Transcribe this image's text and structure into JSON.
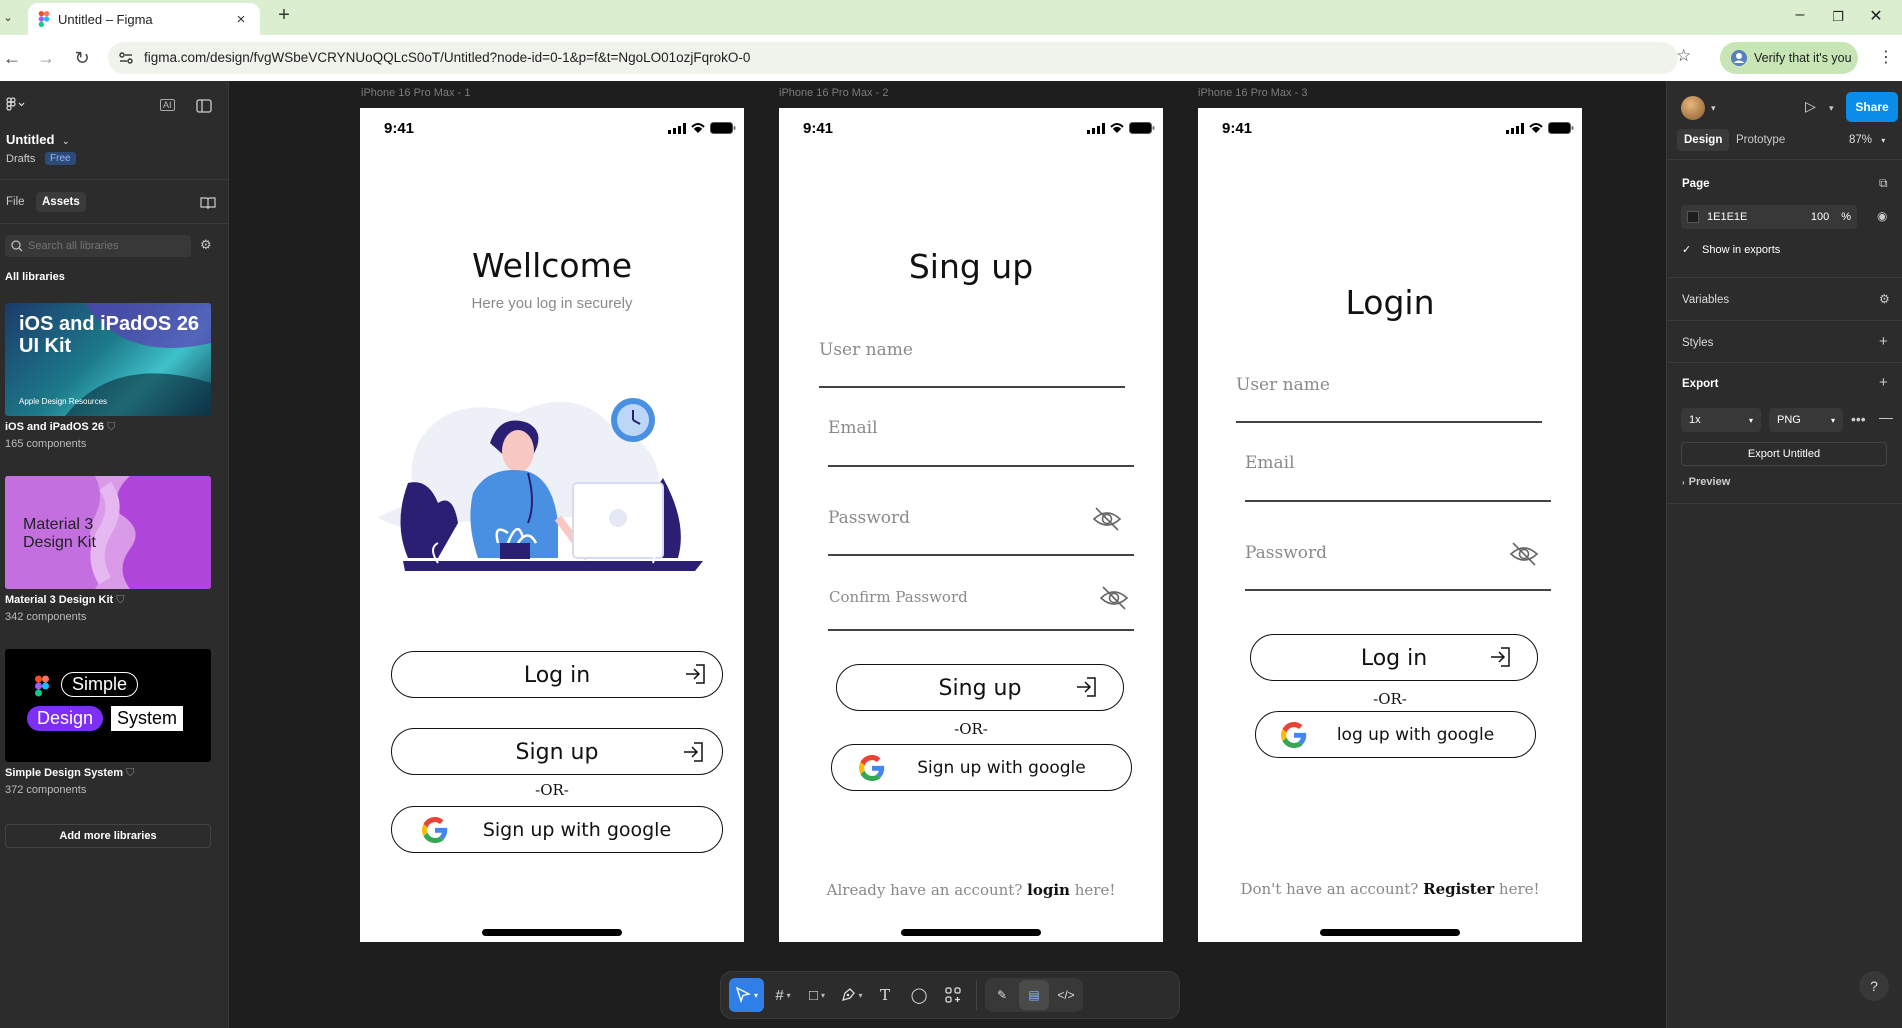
{
  "browser": {
    "tab_title": "Untitled – Figma",
    "url": "figma.com/design/fvgWSbeVCRYNUoQQLcS0oT/Untitled?node-id=0-1&p=f&t=NgoLO01ozjFqrokO-0",
    "verify_label": "Verify that it's you"
  },
  "left_panel": {
    "file_name": "Untitled",
    "drafts_label": "Drafts",
    "plan_badge": "Free",
    "tabs": [
      "File",
      "Assets"
    ],
    "search_placeholder": "Search all libraries",
    "all_libraries_label": "All libraries",
    "libraries": [
      {
        "name": "iOS and iPadOS 26",
        "count": "165 components",
        "thumb_text": "iOS and iPadOS 26 UI Kit",
        "thumb_sub": "Apple Design Resources"
      },
      {
        "name": "Material 3 Design Kit",
        "count": "342 components",
        "thumb_text": "Material 3 Design Kit"
      },
      {
        "name": "Simple Design System",
        "count": "372 components",
        "thumb_words": [
          "Simple",
          "Design",
          "System"
        ]
      }
    ],
    "add_more_label": "Add more libraries"
  },
  "canvas": {
    "frames": [
      {
        "label": "iPhone 16 Pro Max - 1",
        "time": "9:41",
        "title": "Wellcome",
        "subtitle": "Here you log in securely",
        "buttons": [
          "Log in",
          "Sign up"
        ],
        "or_label": "-OR-",
        "google_label": "Sign up with google"
      },
      {
        "label": "iPhone 16 Pro Max - 2",
        "time": "9:41",
        "title": "Sing up",
        "fields": [
          "User name",
          "Email",
          "Password",
          "Confirm Password"
        ],
        "button": "Sing up",
        "or_label": "-OR-",
        "google_label": "Sign up with google",
        "footer_prefix": "Already have an account?",
        "footer_link": "login",
        "footer_suffix": "here!"
      },
      {
        "label": "iPhone 16 Pro Max - 3",
        "time": "9:41",
        "title": "Login",
        "fields": [
          "User name",
          "Email",
          "Password"
        ],
        "button": "Log in",
        "or_label": "-OR-",
        "google_label": "log up with google",
        "footer_prefix": "Don't have an account?",
        "footer_link": "Register",
        "footer_suffix": "here!"
      }
    ]
  },
  "right_panel": {
    "share_label": "Share",
    "tabs": [
      "Design",
      "Prototype"
    ],
    "zoom": "87%",
    "page_heading": "Page",
    "page_color": "1E1E1E",
    "page_opacity": "100",
    "percent_sign": "%",
    "show_in_exports": "Show in exports",
    "variables_heading": "Variables",
    "styles_heading": "Styles",
    "export_heading": "Export",
    "export_scale": "1x",
    "export_format": "PNG",
    "export_button": "Export Untitled",
    "preview_label": "Preview"
  },
  "colors": {
    "accent": "#0c8ce9",
    "canvas_bg": "#1e1e1e",
    "panel_bg": "#2c2c2c",
    "tool_active": "#2f7fe8",
    "illustration_navy": "#2a1f73",
    "illustration_blue": "#4a90e2"
  }
}
